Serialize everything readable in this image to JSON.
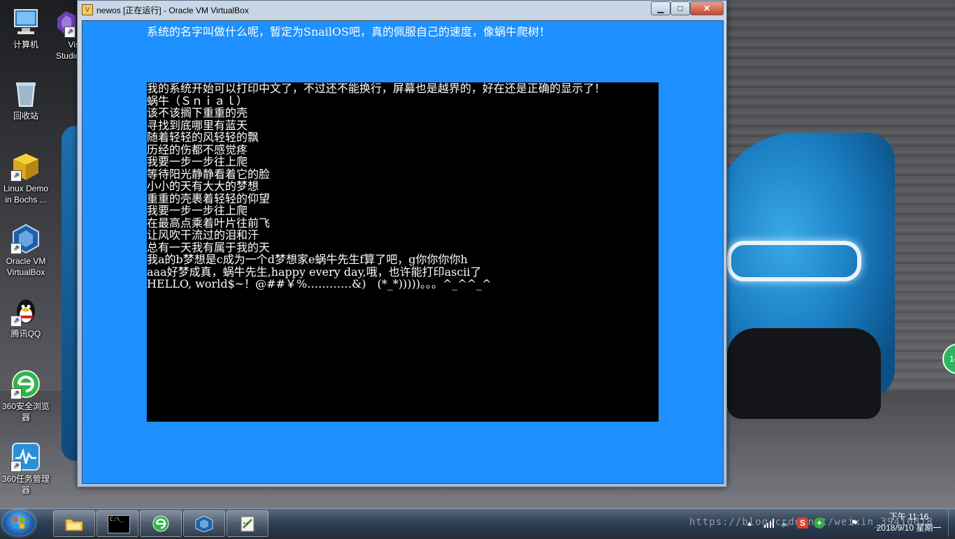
{
  "window": {
    "title": "newos [正在运行] - Oracle VM VirtualBox",
    "minimize_glyph": "▁",
    "maximize_glyph": "□",
    "close_glyph": "✕"
  },
  "vm": {
    "header": "系统的名字叫做什么呢，暂定为SnailOS吧，真的佩服自己的速度，像蜗牛爬树！",
    "console_lines": [
      "我的系统开始可以打印中文了，不过还不能换行，屏幕也是越界的，好在还是正确的显示了！",
      "蜗牛（Ｓｎｉａｌ）",
      "该不该搁下重重的壳",
      "寻找到底哪里有蓝天",
      "随着轻轻的风轻轻的飘",
      "历经的伤都不感觉疼",
      "我要一步一步往上爬",
      "等待阳光静静看着它的脸",
      "小小的天有大大的梦想",
      "重重的壳裹着轻轻的仰望",
      "我要一步一步往上爬",
      "在最高点乘着叶片往前飞",
      "让风吹干流过的泪和汗",
      "总有一天我有属于我的天",
      "我a的b梦想是c成为一个d梦想家e蜗牛先生f算了吧，g你你你你h",
      "aaa好梦成真，蜗牛先生,happy every day,哦，也许能打印ascii了",
      "HELLO, world$~！@##￥%…………&)　(*_*)))))。。。^_^^_^"
    ],
    "colors": {
      "screen_bg": "#1e90ff",
      "console_bg": "#000000",
      "text": "#ffffff"
    }
  },
  "desktop_icons": [
    {
      "label": "计算机"
    },
    {
      "label": "Vis Studio"
    },
    {
      "label": "回收站"
    },
    {
      "label": "Linux Demo in Bochs ..."
    },
    {
      "label": "Oracle VM VirtualBox"
    },
    {
      "label": "腾讯QQ"
    },
    {
      "label": "360安全浏览器"
    },
    {
      "label": "360任务管理器"
    }
  ],
  "taskbar": {
    "items": [
      {
        "name": "file-explorer"
      },
      {
        "name": "command-prompt",
        "glyph": "C:\\_"
      },
      {
        "name": "360-browser"
      },
      {
        "name": "virtualbox"
      },
      {
        "name": "notepad-plus-plus"
      }
    ],
    "clock_time": "下午 11:16",
    "clock_date": "2018/9/10 星期一",
    "watermark": "https://blog.csdn.net/weixin_39410618"
  },
  "badge_text": "14"
}
